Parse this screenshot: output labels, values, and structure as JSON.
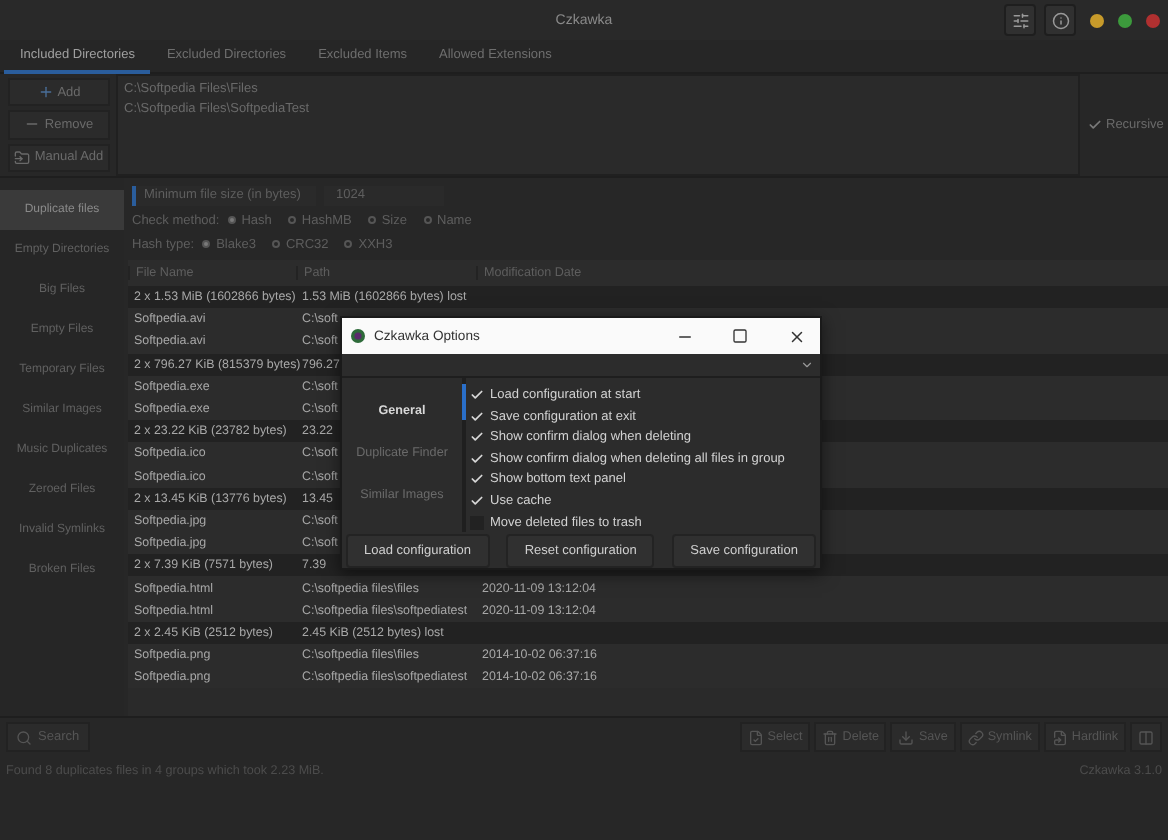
{
  "window": {
    "title": "Czkawka"
  },
  "tabs": [
    {
      "label": "Included Directories",
      "selected": true
    },
    {
      "label": "Excluded Directories",
      "selected": false
    },
    {
      "label": "Excluded Items",
      "selected": false
    },
    {
      "label": "Allowed Extensions",
      "selected": false
    }
  ],
  "directories": {
    "buttons": [
      {
        "kind": "add",
        "label": "Add"
      },
      {
        "kind": "remove",
        "label": "Remove"
      },
      {
        "kind": "manual",
        "label": "Manual Add"
      }
    ],
    "paths": [
      "C:\\Softpedia Files\\Files",
      "C:\\Softpedia Files\\SoftpediaTest"
    ],
    "recursive": {
      "label": "Recursive",
      "checked": true
    }
  },
  "sidebar": {
    "items": [
      {
        "label": "Duplicate files",
        "selected": true
      },
      {
        "label": "Empty Directories",
        "selected": false
      },
      {
        "label": "Big Files",
        "selected": false
      },
      {
        "label": "Empty Files",
        "selected": false
      },
      {
        "label": "Temporary Files",
        "selected": false
      },
      {
        "label": "Similar Images",
        "selected": false
      },
      {
        "label": "Music Duplicates",
        "selected": false
      },
      {
        "label": "Zeroed Files",
        "selected": false
      },
      {
        "label": "Invalid Symlinks",
        "selected": false
      },
      {
        "label": "Broken Files",
        "selected": false
      }
    ]
  },
  "settings": {
    "min_size": {
      "label": "Minimum file size (in bytes)",
      "value": "1024"
    },
    "check_method": {
      "label": "Check method:",
      "options": [
        {
          "label": "Hash",
          "selected": true
        },
        {
          "label": "HashMB",
          "selected": false
        },
        {
          "label": "Size",
          "selected": false
        },
        {
          "label": "Name",
          "selected": false
        }
      ]
    },
    "hash_type": {
      "label": "Hash type:",
      "options": [
        {
          "label": "Blake3",
          "selected": true
        },
        {
          "label": "CRC32",
          "selected": false
        },
        {
          "label": "XXH3",
          "selected": false
        }
      ]
    }
  },
  "table": {
    "columns": [
      "File Name",
      "Path",
      "Modification Date"
    ],
    "rows": [
      {
        "kind": "group",
        "cells": [
          "2 x 1.53 MiB (1602866 bytes)",
          "1.53 MiB (1602866 bytes) lost"
        ]
      },
      {
        "kind": "file",
        "cells": [
          "Softpedia.avi",
          "C:\\soft"
        ]
      },
      {
        "kind": "file",
        "cells": [
          "Softpedia.avi",
          "C:\\soft"
        ]
      },
      {
        "kind": "group",
        "cells": [
          "2 x 796.27 KiB (815379 bytes)",
          "796.27"
        ]
      },
      {
        "kind": "file",
        "cells": [
          "Softpedia.exe",
          "C:\\soft"
        ]
      },
      {
        "kind": "file",
        "cells": [
          "Softpedia.exe",
          "C:\\soft"
        ]
      },
      {
        "kind": "group",
        "cells": [
          "2 x 23.22 KiB (23782 bytes)",
          "23.22"
        ]
      },
      {
        "kind": "file",
        "cells": [
          "Softpedia.ico",
          "C:\\soft"
        ]
      },
      {
        "kind": "file",
        "cells": [
          "Softpedia.ico",
          "C:\\soft"
        ]
      },
      {
        "kind": "group",
        "cells": [
          "2 x 13.45 KiB (13776 bytes)",
          "13.45"
        ]
      },
      {
        "kind": "file",
        "cells": [
          "Softpedia.jpg",
          "C:\\soft"
        ]
      },
      {
        "kind": "file",
        "cells": [
          "Softpedia.jpg",
          "C:\\soft"
        ]
      },
      {
        "kind": "group",
        "cells": [
          "2 x 7.39 KiB (7571 bytes)",
          "7.39"
        ]
      },
      {
        "kind": "file",
        "cells": [
          "Softpedia.html",
          "C:\\softpedia files\\files",
          "2020-11-09 13:12:04"
        ]
      },
      {
        "kind": "file",
        "cells": [
          "Softpedia.html",
          "C:\\softpedia files\\softpediatest",
          "2020-11-09 13:12:04"
        ]
      },
      {
        "kind": "group",
        "cells": [
          "2 x 2.45 KiB (2512 bytes)",
          "2.45 KiB (2512 bytes) lost"
        ]
      },
      {
        "kind": "file",
        "cells": [
          "Softpedia.png",
          "C:\\softpedia files\\files",
          "2014-10-02 06:37:16"
        ]
      },
      {
        "kind": "file",
        "cells": [
          "Softpedia.png",
          "C:\\softpedia files\\softpediatest",
          "2014-10-02 06:37:16"
        ]
      }
    ]
  },
  "search_button": "Search",
  "actions": [
    {
      "kind": "select",
      "label": "Select"
    },
    {
      "kind": "delete",
      "label": "Delete"
    },
    {
      "kind": "save",
      "label": "Save"
    },
    {
      "kind": "symlink",
      "label": "Symlink"
    },
    {
      "kind": "hardlink",
      "label": "Hardlink"
    },
    {
      "kind": "more"
    }
  ],
  "status_bar": {
    "message": "Found 8 duplicates files in 4 groups which took 2.23 MiB.",
    "version": "Czkawka 3.1.0"
  },
  "dialog": {
    "title": "Czkawka Options",
    "tabs": [
      {
        "label": "General",
        "selected": true
      },
      {
        "label": "Duplicate Finder",
        "selected": false
      },
      {
        "label": "Similar Images",
        "selected": false
      }
    ],
    "options": [
      {
        "label": "Load configuration at start",
        "checked": true
      },
      {
        "label": "Save configuration at exit",
        "checked": true
      },
      {
        "label": "Show confirm dialog when deleting",
        "checked": true
      },
      {
        "label": "Show confirm dialog when deleting all files in group",
        "checked": true
      },
      {
        "label": "Show bottom text panel",
        "checked": true
      },
      {
        "label": "Use cache",
        "checked": true
      },
      {
        "label": "Move deleted files to trash",
        "checked": false
      }
    ],
    "buttons": [
      "Load configuration",
      "Reset configuration",
      "Save configuration"
    ]
  }
}
